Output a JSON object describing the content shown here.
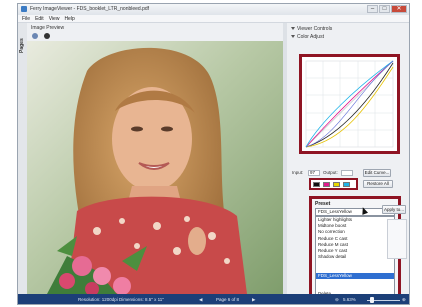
{
  "window": {
    "title": "Ferry ImageViewer - FDS_booklet_LTR_nonbleed.pdf"
  },
  "menu": [
    "File",
    "Edit",
    "View",
    "Help"
  ],
  "left_panel": {
    "pages_label": "Pages",
    "preview_title": "Image Preview"
  },
  "right_panel": {
    "viewer_controls": "Viewer Controls",
    "color_adjust": "Color Adjust",
    "input_label": "Input:",
    "input_value": "97",
    "output_label": "Output:",
    "output_value": "",
    "edit_curve_label": "Edit Curve...",
    "restore_label": "Restore All",
    "channel_colors": [
      "#111111",
      "#e21a8d",
      "#e6d700",
      "#1fb4e8"
    ]
  },
  "preset": {
    "title": "Preset",
    "selected": "FDS_LessYellow",
    "apply_label": "Apply to...",
    "items": [
      "Lighter highlights",
      "Midtone boost",
      "No correction",
      "Reduce C cast",
      "Reduce M cast",
      "Reduce Y cast",
      "Shadow detail",
      "",
      "",
      "FDS_LessYellow",
      "",
      "",
      "Delete",
      "Save As"
    ],
    "selected_index": 9
  },
  "status": {
    "resolution": "Resolution: 1200dpi  Dimensions: 8.5\" x 11\"",
    "page": "Page 6 of 8",
    "zoom": "5.63%"
  },
  "colors": {
    "accent_red": "#8f1423",
    "status_bar": "#1c3f78",
    "selection": "#2f6fd1"
  }
}
